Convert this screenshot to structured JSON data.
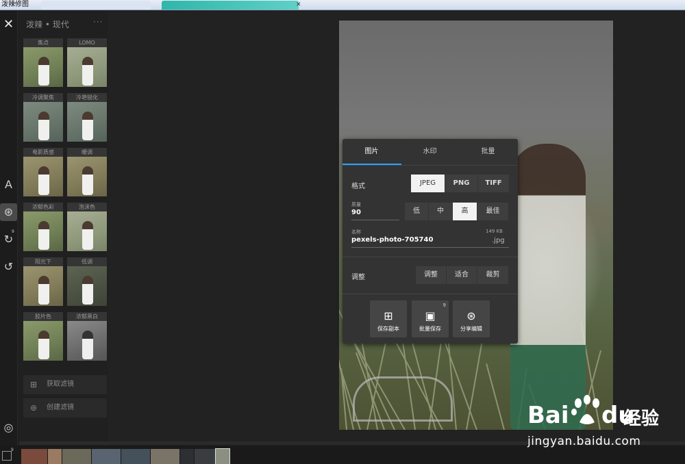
{
  "window": {
    "title": "泼辣修图",
    "tab_close": "✕"
  },
  "iconbar": {
    "close_glyph": "✕",
    "items": [
      {
        "name": "text-icon",
        "glyph": "A"
      },
      {
        "name": "filter-icon",
        "glyph": "⊛"
      },
      {
        "name": "history-icon",
        "glyph": "↻",
        "badge": "9"
      },
      {
        "name": "reset-icon",
        "glyph": "↺"
      },
      {
        "name": "settings-icon",
        "glyph": "◎"
      }
    ]
  },
  "filters_panel": {
    "title": "泼辣 • 现代",
    "more": "···",
    "filters": [
      {
        "label": "焦点",
        "tone": "normal"
      },
      {
        "label": "LOMO",
        "tone": "light"
      },
      {
        "label": "冷调聚焦",
        "tone": "cool"
      },
      {
        "label": "冷艳锐化",
        "tone": "cool"
      },
      {
        "label": "电影质感",
        "tone": "warm"
      },
      {
        "label": "暖调",
        "tone": "warm"
      },
      {
        "label": "浓郁色彩",
        "tone": "normal"
      },
      {
        "label": "泡沫色",
        "tone": "light"
      },
      {
        "label": "阳光下",
        "tone": "warm"
      },
      {
        "label": "低调",
        "tone": "dark"
      },
      {
        "label": "胶片色",
        "tone": "normal"
      },
      {
        "label": "浓郁黑白",
        "tone": "bw"
      }
    ],
    "get_filter_button": "获取滤镜",
    "get_filter_icon": "grid-icon",
    "create_filter_button": "创建滤镜",
    "create_filter_icon": "layers-icon"
  },
  "export_panel": {
    "tabs": [
      "图片",
      "水印",
      "批量"
    ],
    "active_tab": "图片",
    "format": {
      "label": "格式",
      "options": [
        "JPEG",
        "PNG",
        "TIFF"
      ],
      "selected": "JPEG"
    },
    "quality": {
      "label": "质量",
      "value": "90",
      "options": [
        "低",
        "中",
        "高",
        "最佳"
      ],
      "selected": "高"
    },
    "name": {
      "label": "名称",
      "value": "pexels-photo-705740",
      "size": "149 KB",
      "extension": ".jpg"
    },
    "adjust": {
      "label": "调整",
      "options": [
        "调整",
        "适合",
        "裁剪"
      ]
    },
    "actions": [
      {
        "label": "保存副本",
        "icon": "save-copy-icon",
        "glyph": "⊞"
      },
      {
        "label": "批量保存",
        "icon": "batch-save-icon",
        "glyph": "▣",
        "badge": "9"
      },
      {
        "label": "分享编辑",
        "icon": "share-edit-icon",
        "glyph": "⊛"
      }
    ]
  },
  "filmstrip": {
    "badge": "9",
    "colors": [
      "#7a4a3c",
      "#9a7a60",
      "#6b6a5a",
      "#5a6470",
      "#44505a",
      "#7a7468",
      "#2e2f33",
      "#3a3d40",
      "#8a8f80"
    ],
    "selected_index": 8
  },
  "watermark": {
    "bai": "Bai",
    "du": "du",
    "cn": "经验",
    "url": "jingyan.baidu.com"
  }
}
